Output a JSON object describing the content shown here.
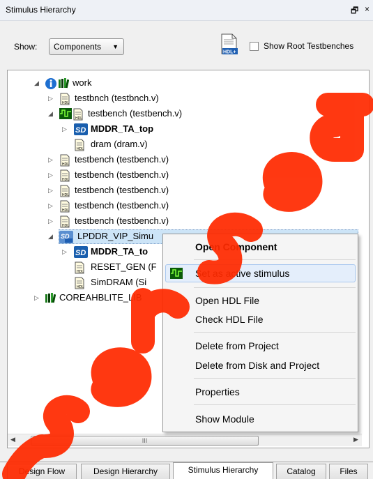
{
  "panel": {
    "title": "Stimulus Hierarchy",
    "restore_glyph": "🗗",
    "close_glyph": "×"
  },
  "toolbar": {
    "show_label": "Show:",
    "show_value": "Components",
    "checkbox_label": "Show Root Testbenches",
    "checkbox_checked": false
  },
  "tree": {
    "work": "work",
    "rows": [
      "testbnch (testbnch.v)",
      "testbench (testbench.v)",
      "MDDR_TA_top",
      "dram (dram.v)",
      "testbench (testbench.v)",
      "testbench (testbench.v)",
      "testbench (testbench.v)",
      "testbench (testbench.v)",
      "testbench (testbench.v)",
      "LPDDR_VIP_Simu",
      "MDDR_TA_to",
      "RESET_GEN (F",
      "SimDRAM (Si",
      "COREAHBLITE_LIB"
    ]
  },
  "context_menu": {
    "open_component": "Open Component",
    "set_active": "Set as active stimulus",
    "open_hdl": "Open HDL File",
    "check_hdl": "Check HDL File",
    "delete_project": "Delete from Project",
    "delete_disk": "Delete from Disk and Project",
    "properties": "Properties",
    "show_module": "Show Module"
  },
  "scrollbar": {
    "grip": "III"
  },
  "tabs": [
    "Design Flow",
    "Design Hierarchy",
    "Stimulus Hierarchy",
    "Catalog",
    "Files"
  ],
  "active_tab": "Stimulus Hierarchy",
  "watermark": {
    "color": "#ff2a00"
  }
}
